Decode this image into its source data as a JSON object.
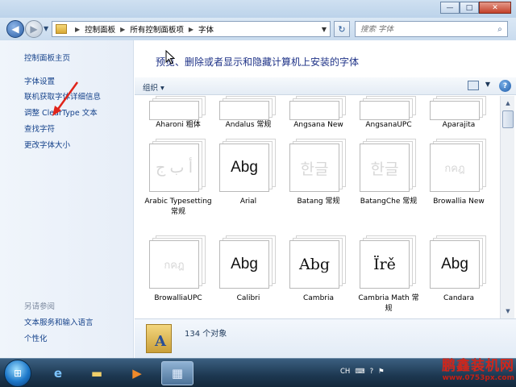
{
  "window": {
    "minimize_icon": "minimize-icon",
    "maximize_icon": "maximize-icon",
    "close_icon": "close-icon"
  },
  "navigation": {
    "breadcrumb": [
      "控制面板",
      "所有控制面板项",
      "字体"
    ],
    "search_placeholder": "搜索 字体"
  },
  "sidebar": {
    "home": "控制面板主页",
    "links": [
      "字体设置",
      "联机获取字体详细信息",
      "调整 ClearType 文本",
      "查找字符",
      "更改字体大小"
    ],
    "see_also_title": "另请参阅",
    "see_also": [
      "文本服务和输入语言",
      "个性化"
    ]
  },
  "main": {
    "title": "预览、删除或者显示和隐藏计算机上安装的字体",
    "organize": "组织 ▾"
  },
  "fonts": [
    {
      "name": "Aharoni 粗体",
      "sample": "",
      "faded": true
    },
    {
      "name": "Andalus 常规",
      "sample": "",
      "faded": true
    },
    {
      "name": "Angsana New",
      "sample": "",
      "faded": true
    },
    {
      "name": "AngsanaUPC",
      "sample": "",
      "faded": true
    },
    {
      "name": "Aparajita",
      "sample": "",
      "faded": true
    },
    {
      "name": "Arabic Typesetting 常规",
      "sample": "أ ب ج",
      "faded": true
    },
    {
      "name": "Arial",
      "sample": "Abg",
      "faded": false
    },
    {
      "name": "Batang 常规",
      "sample": "한글",
      "faded": true
    },
    {
      "name": "BatangChe 常规",
      "sample": "한글",
      "faded": true
    },
    {
      "name": "Browallia New",
      "sample": "กคฎ",
      "faded": true
    },
    {
      "name": "BrowalliaUPC",
      "sample": "กคฎ",
      "faded": true
    },
    {
      "name": "Calibri",
      "sample": "Abg",
      "faded": false
    },
    {
      "name": "Cambria",
      "sample": "Abg",
      "faded": false
    },
    {
      "name": "Cambria Math 常规",
      "sample": "Ïrě",
      "faded": false
    },
    {
      "name": "Candara",
      "sample": "Abg",
      "faded": false
    }
  ],
  "details": {
    "count": "134 个对象"
  },
  "taskbar": {
    "tray": [
      "CH",
      "?"
    ],
    "brand": "鹏鑫装机网",
    "brand_url": "www.0753px.com"
  }
}
